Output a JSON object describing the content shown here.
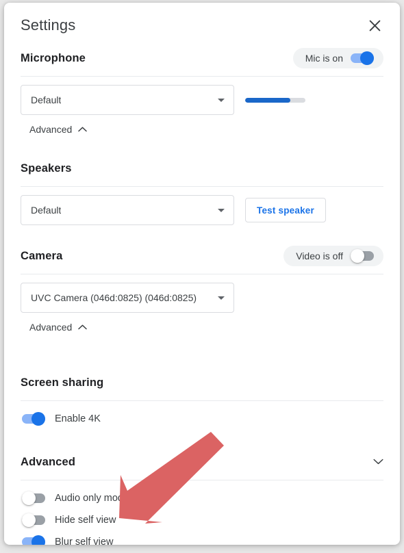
{
  "dialog": {
    "title": "Settings",
    "close_icon": "close-icon"
  },
  "microphone": {
    "heading": "Microphone",
    "toggle_label": "Mic is on",
    "toggle_state": "on",
    "device_value": "Default",
    "level_percent": 75,
    "advanced_label": "Advanced",
    "advanced_caret": "chevron-up-icon"
  },
  "speakers": {
    "heading": "Speakers",
    "device_value": "Default",
    "test_button_label": "Test speaker"
  },
  "camera": {
    "heading": "Camera",
    "toggle_label": "Video is off",
    "toggle_state": "off",
    "device_value": "UVC Camera (046d:0825) (046d:0825)",
    "advanced_label": "Advanced",
    "advanced_caret": "chevron-up-icon"
  },
  "screen_sharing": {
    "heading": "Screen sharing",
    "options": [
      {
        "label": "Enable 4K",
        "state": "on"
      }
    ]
  },
  "advanced": {
    "heading": "Advanced",
    "caret": "chevron-down-icon",
    "options": [
      {
        "label": "Audio only mode",
        "state": "off"
      },
      {
        "label": "Hide self view",
        "state": "off"
      },
      {
        "label": "Blur self view",
        "state": "on"
      }
    ]
  },
  "annotation": {
    "arrow_color": "#db6363",
    "arrow_direction": "down-left"
  },
  "colors": {
    "accent_blue": "#1a73e8",
    "track_blue": "#8ab4f8",
    "meter_blue": "#1a67c9",
    "track_grey": "#9aa0a6",
    "pill_bg": "#f1f3f4",
    "border": "#dadce0",
    "text": "#3c4043",
    "heading": "#202124"
  }
}
